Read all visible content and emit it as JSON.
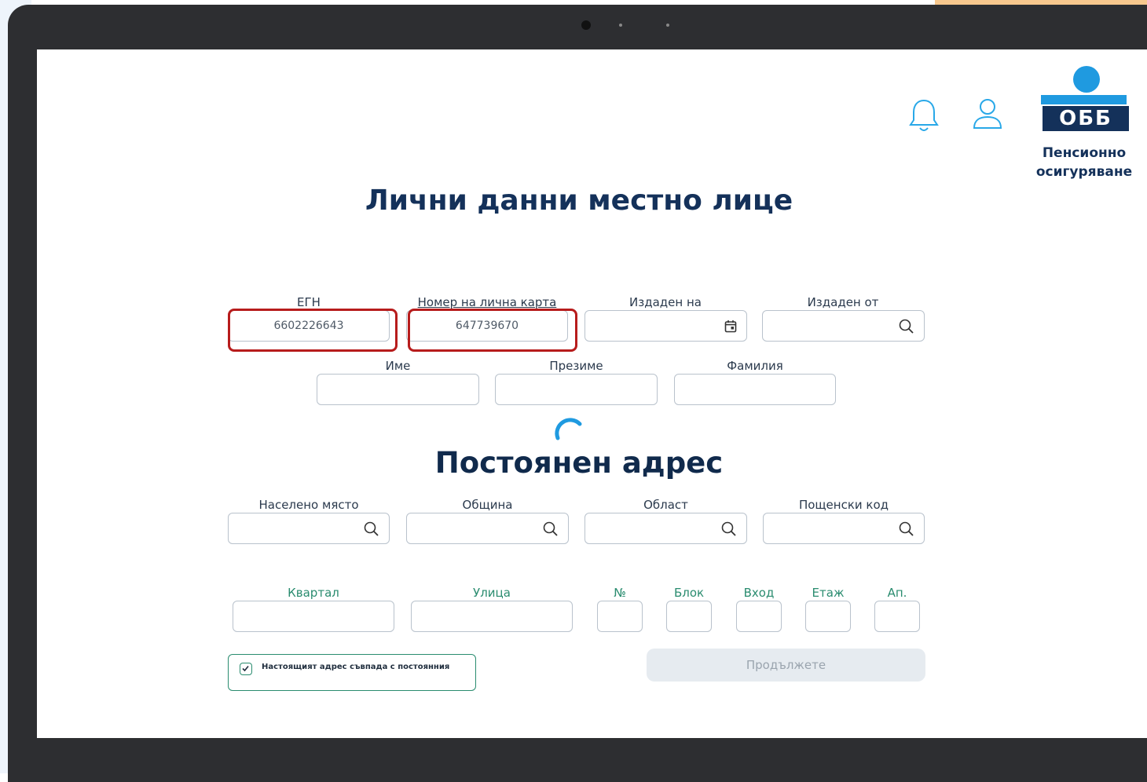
{
  "header": {
    "logo_mark": "ОББ",
    "logo_line1": "Пенсионно",
    "logo_line2": "осигуряване",
    "icons": [
      "bell-icon",
      "user-icon"
    ]
  },
  "personal": {
    "title": "Лични данни местно лице",
    "egn_label": "ЕГН",
    "egn_value": "6602226643",
    "id_label": "Номер на лична карта",
    "id_value": "647739670",
    "issued_on_label": "Издаден на",
    "issued_by_label": "Издаден от",
    "first_name_label": "Име",
    "middle_name_label": "Презиме",
    "last_name_label": "Фамилия"
  },
  "address": {
    "title": "Постоянен адрес",
    "settlement_label": "Населено място",
    "municipality_label": "Община",
    "region_label": "Област",
    "postcode_label": "Пощенски код",
    "district_label": "Квартал",
    "street_label": "Улица",
    "number_label": "№",
    "block_label": "Блок",
    "entrance_label": "Вход",
    "floor_label": "Етаж",
    "apartment_label": "Ап."
  },
  "current_address_checkbox": {
    "label": "Настоящият адрес съвпада с постоянния",
    "checked": true
  },
  "continue_button": {
    "label": "Продължете",
    "enabled": false
  },
  "colors": {
    "brand_navy": "#14315a",
    "brand_blue": "#1f9ae0",
    "accent_green": "#2a8c6f",
    "highlight_red": "#b71c1c"
  }
}
